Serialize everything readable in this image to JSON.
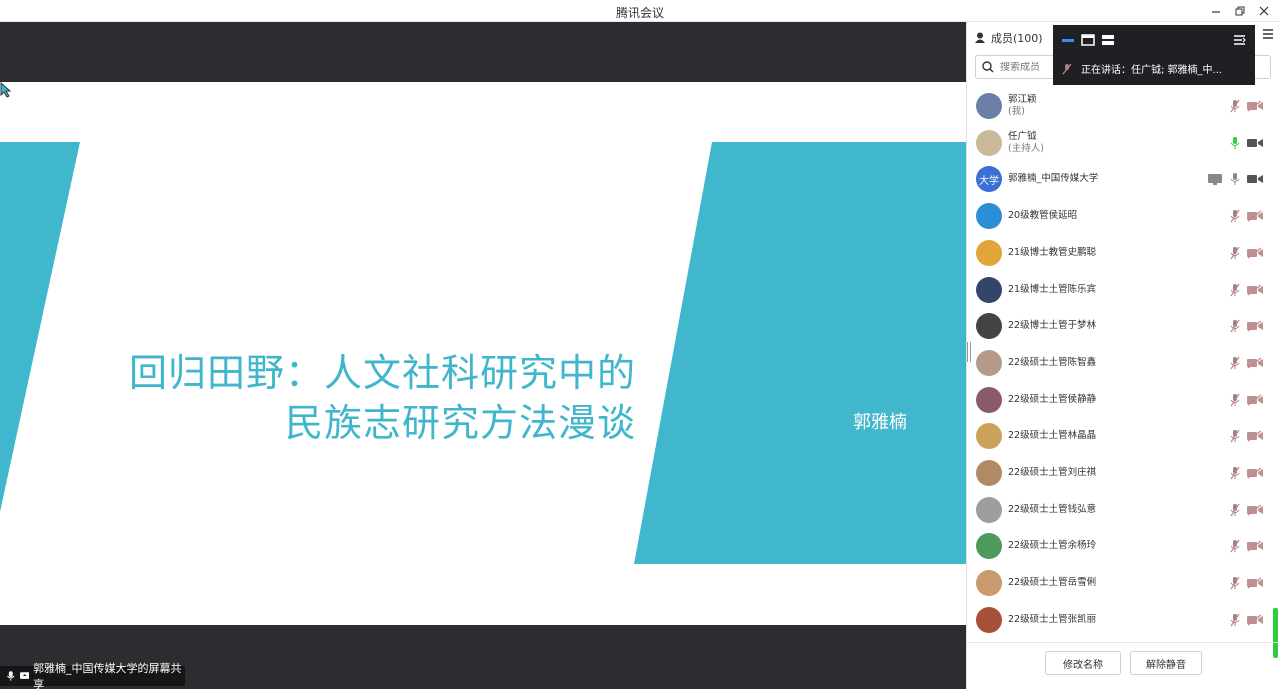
{
  "window": {
    "title": "腾讯会议"
  },
  "slide": {
    "title_line1": "回归田野：人文社科研究中的",
    "title_line2": "民族志研究方法漫谈",
    "author": "郭雅楠",
    "accent_color": "#40b7cd"
  },
  "share_bar": {
    "label": "郭雅楠_中国传媒大学的屏幕共享"
  },
  "panel": {
    "members_label": "成员(100)",
    "search_placeholder": "搜索成员",
    "speaking": "正在讲话：任广钺; 郭雅楠_中..."
  },
  "members": [
    {
      "name": "郭江颖",
      "role": "(我)",
      "mic": "muted",
      "cam": "off"
    },
    {
      "name": "任广钺",
      "role": "(主持人)",
      "mic": "active",
      "cam": "on"
    },
    {
      "name": "郭雅楠_中国传媒大学",
      "role": "",
      "mic": "on",
      "cam": "on",
      "sharing": true,
      "avatar_text": "大学"
    },
    {
      "name": "20级教管侯延昭",
      "role": "",
      "mic": "muted",
      "cam": "off"
    },
    {
      "name": "21级博士教管史鹏聪",
      "role": "",
      "mic": "muted",
      "cam": "off"
    },
    {
      "name": "21级博士土管陈乐宾",
      "role": "",
      "mic": "muted",
      "cam": "off"
    },
    {
      "name": "22级博士土管于梦林",
      "role": "",
      "mic": "muted",
      "cam": "off"
    },
    {
      "name": "22级硕士土管陈智鑫",
      "role": "",
      "mic": "muted",
      "cam": "off"
    },
    {
      "name": "22级硕士土管侯静静",
      "role": "",
      "mic": "muted",
      "cam": "off"
    },
    {
      "name": "22级硕士土管林晶晶",
      "role": "",
      "mic": "muted",
      "cam": "off"
    },
    {
      "name": "22级硕士土管刘庄祺",
      "role": "",
      "mic": "muted",
      "cam": "off"
    },
    {
      "name": "22级硕士土管钱弘意",
      "role": "",
      "mic": "muted",
      "cam": "off"
    },
    {
      "name": "22级硕士土管余杨玲",
      "role": "",
      "mic": "muted",
      "cam": "off"
    },
    {
      "name": "22级硕士土管岳雪俐",
      "role": "",
      "mic": "muted",
      "cam": "off"
    },
    {
      "name": "22级硕士土管张凯丽",
      "role": "",
      "mic": "muted",
      "cam": "off"
    }
  ],
  "footer": {
    "rename_label": "修改名称",
    "unmute_label": "解除静音"
  },
  "colors": {
    "active_mic": "#2ecc40",
    "muted": "#e07a7a",
    "avatar_blue": "#3a6fd8"
  }
}
